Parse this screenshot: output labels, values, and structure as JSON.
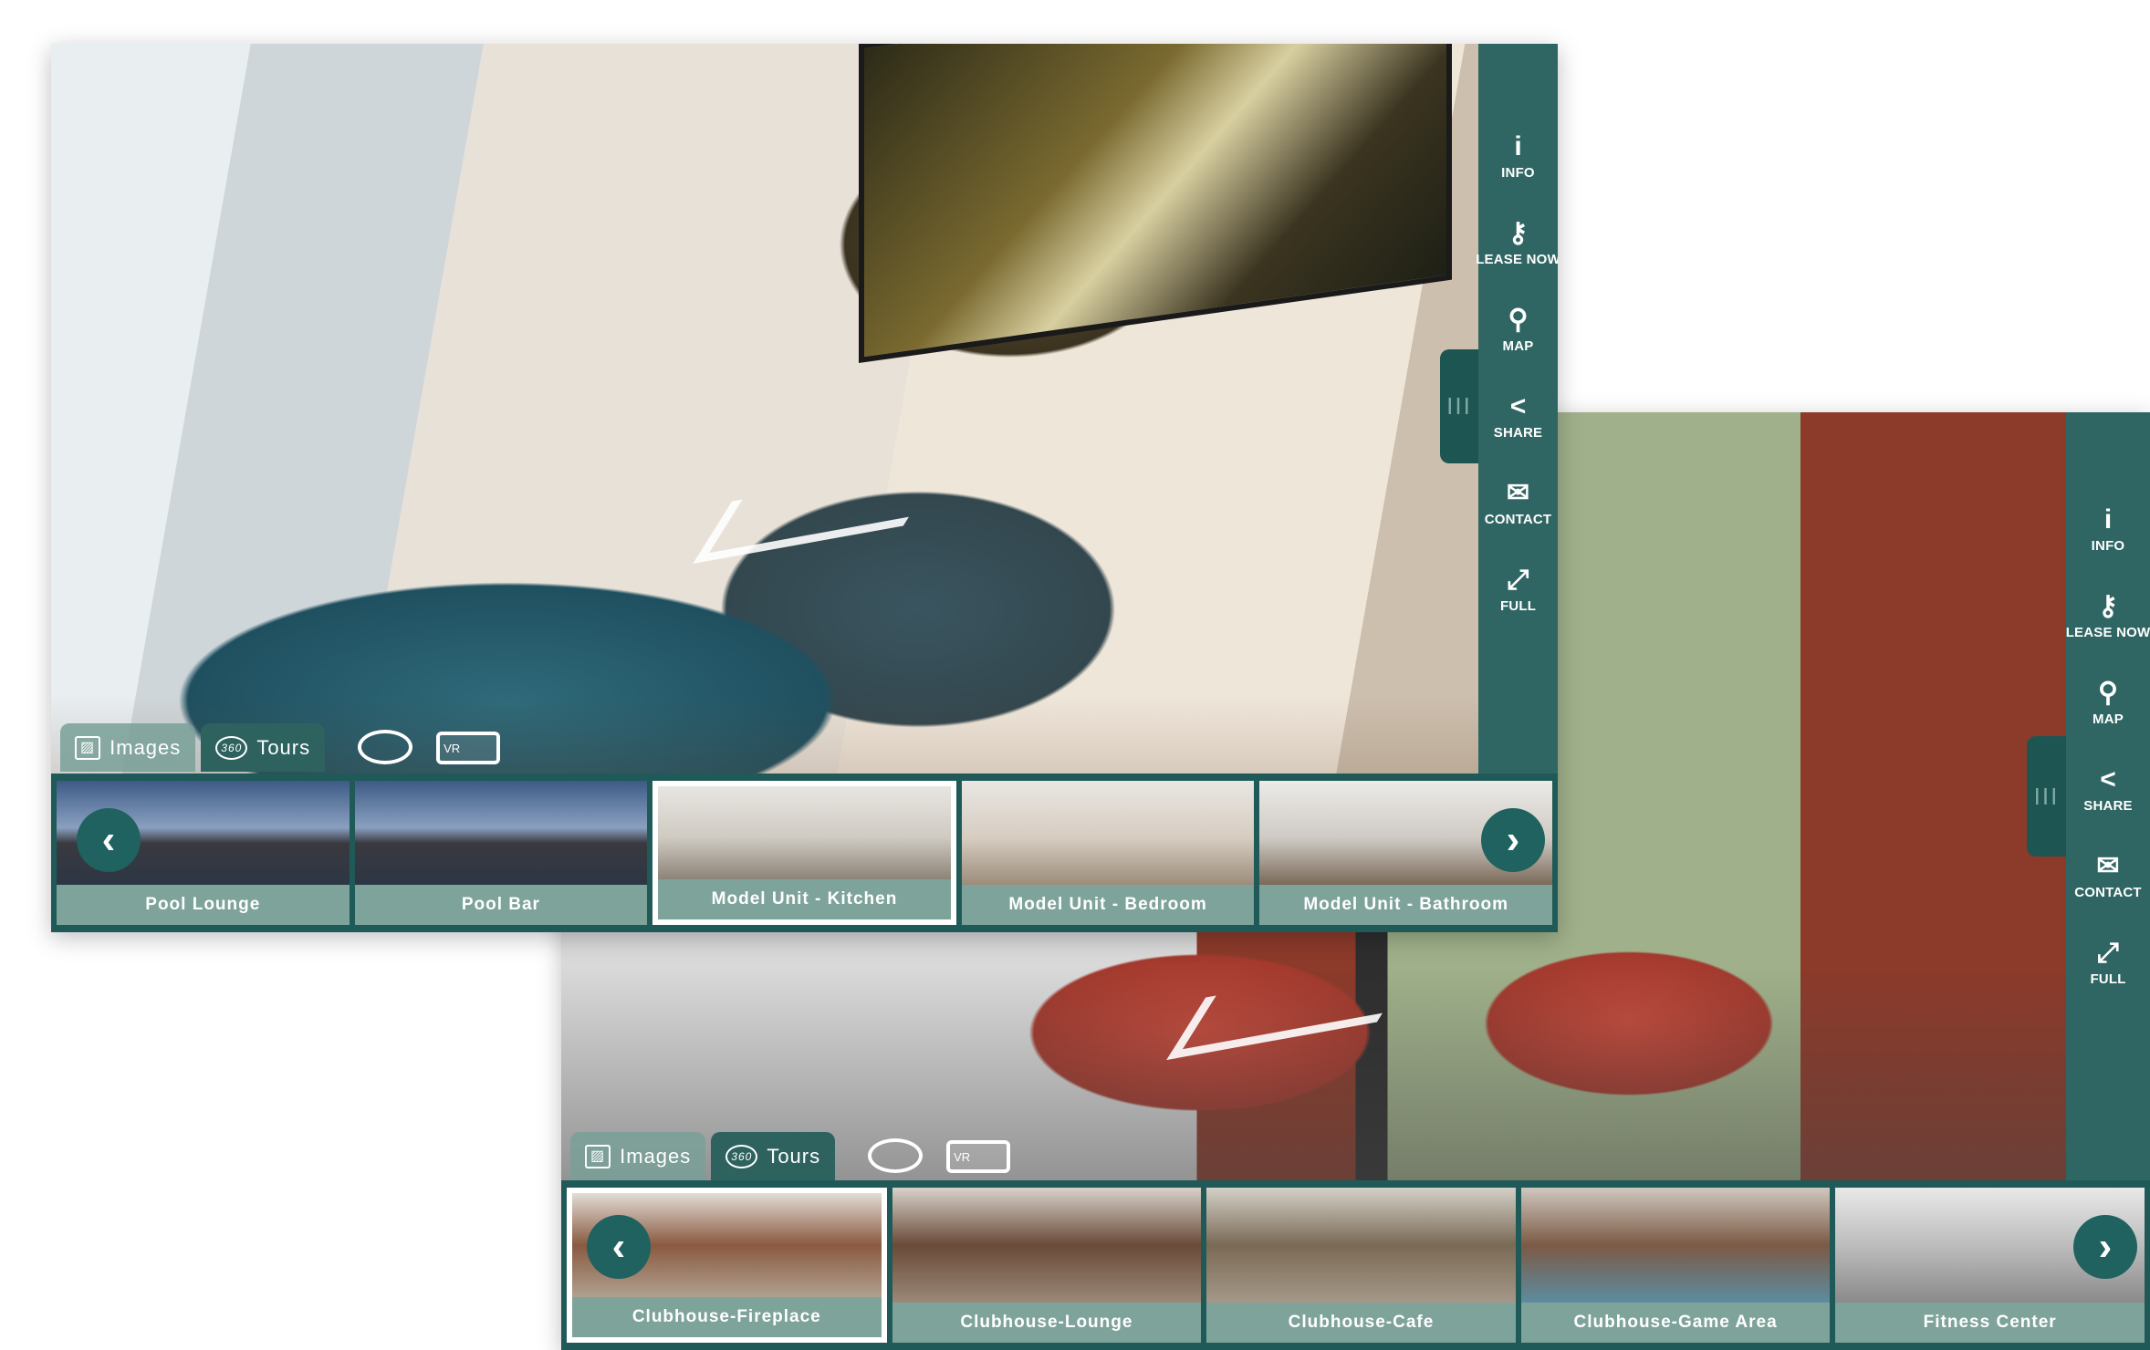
{
  "colors": {
    "sidebar": "#2f6663",
    "bar": "#1f5a58",
    "label": "#7ea39a"
  },
  "sidebar": [
    {
      "label": "INFO",
      "icon": "info-icon",
      "glyph": "i"
    },
    {
      "label": "LEASE NOW",
      "icon": "key-icon",
      "glyph": "⚷"
    },
    {
      "label": "MAP",
      "icon": "map-pin-icon",
      "glyph": "⚲"
    },
    {
      "label": "SHARE",
      "icon": "share-icon",
      "glyph": "<"
    },
    {
      "label": "CONTACT",
      "icon": "envelope-icon",
      "glyph": "✉"
    },
    {
      "label": "FULL",
      "icon": "fullscreen-icon",
      "glyph": "⤢"
    }
  ],
  "tabs": {
    "images": "Images",
    "tours": "Tours",
    "tours_badge": "360",
    "vr": "VR"
  },
  "handle": "III",
  "arrows": {
    "prev": "‹",
    "next": "›"
  },
  "window1": {
    "thumbs": [
      {
        "label": "Pool Lounge",
        "bg": "linear-gradient(180deg,#3d5a86,#8aa0c0 45%,#3a3a40 60%,#2c3644)"
      },
      {
        "label": "Pool Bar",
        "bg": "linear-gradient(180deg,#3d5a86,#8aa0c0 45%,#3a3a40 60%,#2c3644)"
      },
      {
        "label": "Model Unit - Kitchen",
        "bg": "linear-gradient(180deg,#e8e6e2,#cfcac2 55%,#8d8478)",
        "selected": true
      },
      {
        "label": "Model Unit - Bedroom",
        "bg": "linear-gradient(180deg,#e9e7e3,#d6ccc0 55%,#9c8c7a)"
      },
      {
        "label": "Model Unit - Bathroom",
        "bg": "linear-gradient(180deg,#ecebe8,#cfcac4 55%,#7a6a58)"
      }
    ]
  },
  "window2": {
    "thumbs": [
      {
        "label": "Clubhouse-Fireplace",
        "bg": "linear-gradient(180deg,#e2ddd6,#8a5a40 50%,#b0a090)",
        "selected": true
      },
      {
        "label": "Clubhouse-Lounge",
        "bg": "linear-gradient(180deg,#d8d2ca,#6a4a38 50%,#9a8878)"
      },
      {
        "label": "Clubhouse-Cafe",
        "bg": "linear-gradient(180deg,#d4d0c8,#7a6a55 50%,#a59888)"
      },
      {
        "label": "Clubhouse-Game Area",
        "bg": "linear-gradient(180deg,#cfc8bf,#7c5a45 50%,#5c8ca0)"
      },
      {
        "label": "Fitness Center",
        "bg": "linear-gradient(180deg,#e8e8e8,#bdbdbd 50%,#8a8a8a)"
      }
    ]
  }
}
